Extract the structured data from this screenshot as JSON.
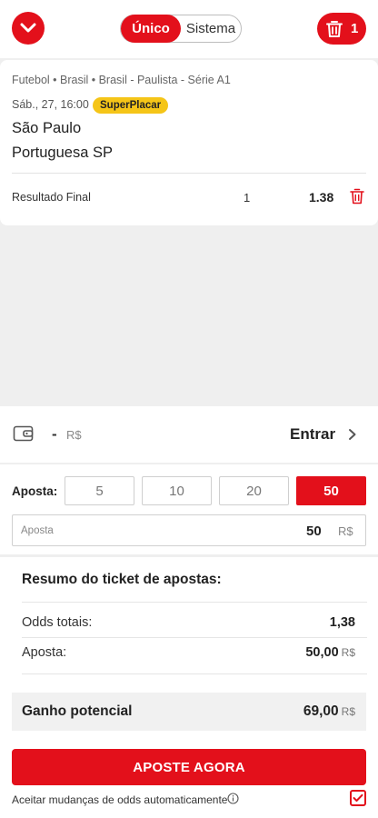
{
  "header": {
    "mode_active": "Único",
    "mode_inactive": "Sistema",
    "trash_count": "1"
  },
  "bet": {
    "breadcrumb": "Futebol • Brasil • Brasil - Paulista - Série A1",
    "datetime": "Sáb., 27, 16:00",
    "badge": "SuperPlacar",
    "team_home": "São Paulo",
    "team_away": "Portuguesa SP",
    "market": "Resultado Final",
    "selection": "1",
    "odd": "1.38"
  },
  "wallet": {
    "balance": "-",
    "currency": "R$",
    "enter_label": "Entrar"
  },
  "stake": {
    "label": "Aposta:",
    "chips": [
      "5",
      "10",
      "20",
      "50"
    ],
    "selected_chip": "50",
    "input_placeholder": "Aposta",
    "input_value": "50",
    "input_currency": "R$"
  },
  "summary": {
    "title": "Resumo do ticket de apostas:",
    "total_odds_label": "Odds totais:",
    "total_odds_value": "1,38",
    "stake_label": "Aposta:",
    "stake_value": "50,00",
    "stake_currency": "R$",
    "gain_label": "Ganho potencial",
    "gain_value": "69,00",
    "gain_currency": "R$",
    "cta_label": "APOSTE AGORA",
    "accept_label": "Aceitar mudanças de odds automaticamente",
    "accept_checked": true
  },
  "colors": {
    "accent": "#e3101b",
    "badge": "#f5c518",
    "background": "#efefef"
  },
  "icons": [
    "chevron-down-icon",
    "trash-icon",
    "wallet-icon",
    "chevron-right-icon",
    "info-icon",
    "checkmark-icon"
  ]
}
